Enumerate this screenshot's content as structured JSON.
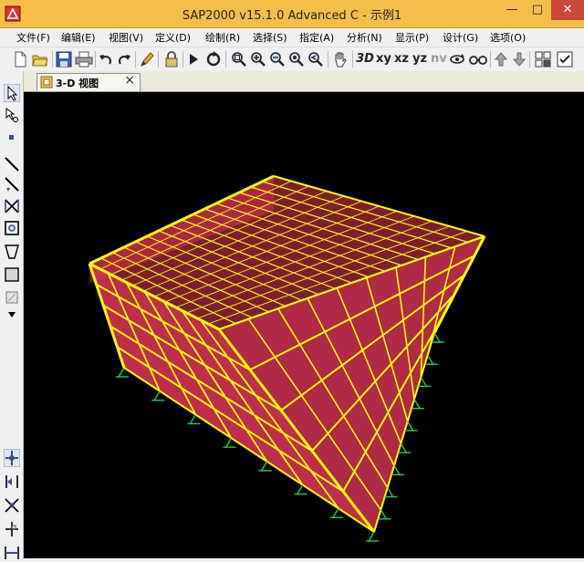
{
  "window": {
    "title": "SAP2000 v15.1.0 Advanced C  - 示例1",
    "minimize": "—",
    "maximize": "□",
    "close": "✕"
  },
  "menu": [
    {
      "label": "文件(F)"
    },
    {
      "label": "编辑(E)"
    },
    {
      "label": "视图(V)"
    },
    {
      "label": "定义(D)"
    },
    {
      "label": "绘制(R)"
    },
    {
      "label": "选择(S)"
    },
    {
      "label": "指定(A)"
    },
    {
      "label": "分析(N)"
    },
    {
      "label": "显示(P)"
    },
    {
      "label": "设计(G)"
    },
    {
      "label": "选项(O)"
    }
  ],
  "toolbar": {
    "view_3d_label": "3D",
    "view_xy_label": "xy",
    "view_xz_label": "xz",
    "view_yz_label": "yz",
    "view_nv_label": "nv"
  },
  "tabs": [
    {
      "label": "3-D 视图",
      "close": "×"
    }
  ],
  "colors": {
    "title_bar": "#f5bf47",
    "close_button": "#c9473b",
    "viewport_background": "#000000",
    "frame_lines": "#ffff00",
    "area_shell": "#e2345a",
    "restraints": "#1fd24a"
  },
  "icons": {
    "toolbar": [
      "new-icon",
      "open-icon",
      "save-icon",
      "print-icon",
      "undo-icon",
      "redo-icon",
      "pencil-icon",
      "lock-icon",
      "run-icon",
      "refresh-icon",
      "zoom-window-icon",
      "zoom-in-icon",
      "zoom-out-icon",
      "zoom-extents-icon",
      "zoom-previous-icon",
      "pan-hand-icon",
      "rotate-icon",
      "perspective-icon",
      "arrow-up-icon",
      "arrow-down-icon",
      "grid-icon",
      "checkbox-icon"
    ],
    "left_strip": [
      "pointer-icon",
      "reshape-icon",
      "draw-joint-icon",
      "draw-frame-icon",
      "quick-frame-icon",
      "draw-brace-icon",
      "draw-area-icon",
      "draw-poly-area-icon",
      "draw-rect-area-icon",
      "draw-solid-icon",
      "snap-joint-icon",
      "snap-end-icon",
      "snap-intersection-icon",
      "snap-perpendicular-icon",
      "snap-line-icon"
    ]
  }
}
